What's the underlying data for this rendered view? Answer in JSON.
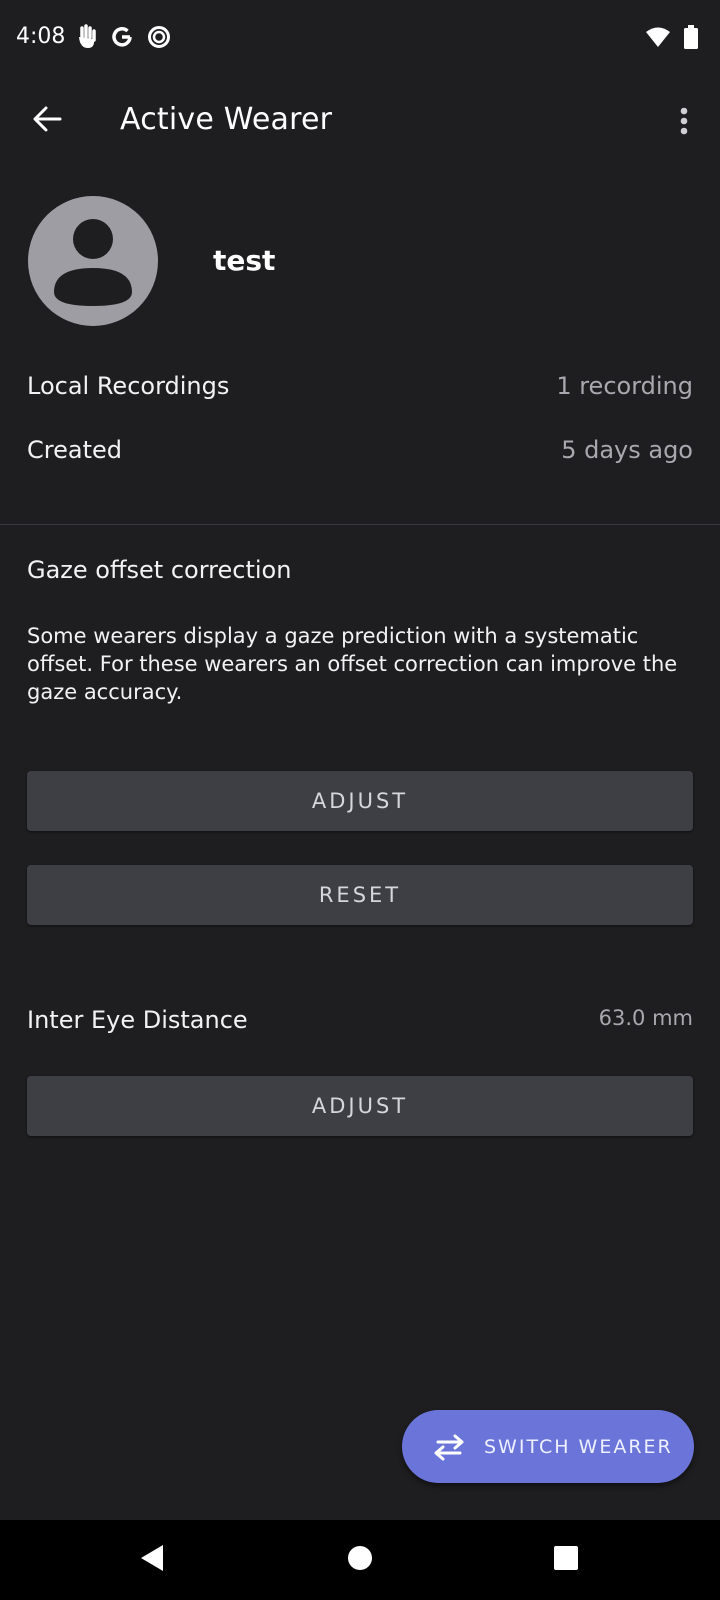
{
  "status_bar": {
    "time": "4:08",
    "icons": [
      "hand-gesture-icon",
      "google-icon",
      "circle-record-icon",
      "wifi-icon",
      "battery-icon"
    ]
  },
  "app_bar": {
    "title": "Active Wearer",
    "back_icon": "arrow-back-icon",
    "more_icon": "more-vert-icon"
  },
  "profile": {
    "name": "test",
    "avatar_icon": "account-circle-icon"
  },
  "info": {
    "local_recordings_label": "Local Recordings",
    "local_recordings_value": "1 recording",
    "created_label": "Created",
    "created_value": "5 days ago"
  },
  "gaze_offset": {
    "title": "Gaze offset correction",
    "description": "Some wearers display a gaze prediction with a systematic offset. For these wearers an offset correction can improve the gaze accuracy.",
    "adjust_label": "ADJUST",
    "reset_label": "RESET"
  },
  "inter_eye": {
    "title": "Inter Eye Distance",
    "value": "63.0 mm",
    "adjust_label": "ADJUST"
  },
  "fab": {
    "label": "SWITCH WEARER",
    "icon": "swap-horiz-icon"
  },
  "colors": {
    "background": "#1e1e21",
    "button": "#3e3e45",
    "accent": "#6b75d9",
    "secondary_text": "#a9a8ae"
  }
}
